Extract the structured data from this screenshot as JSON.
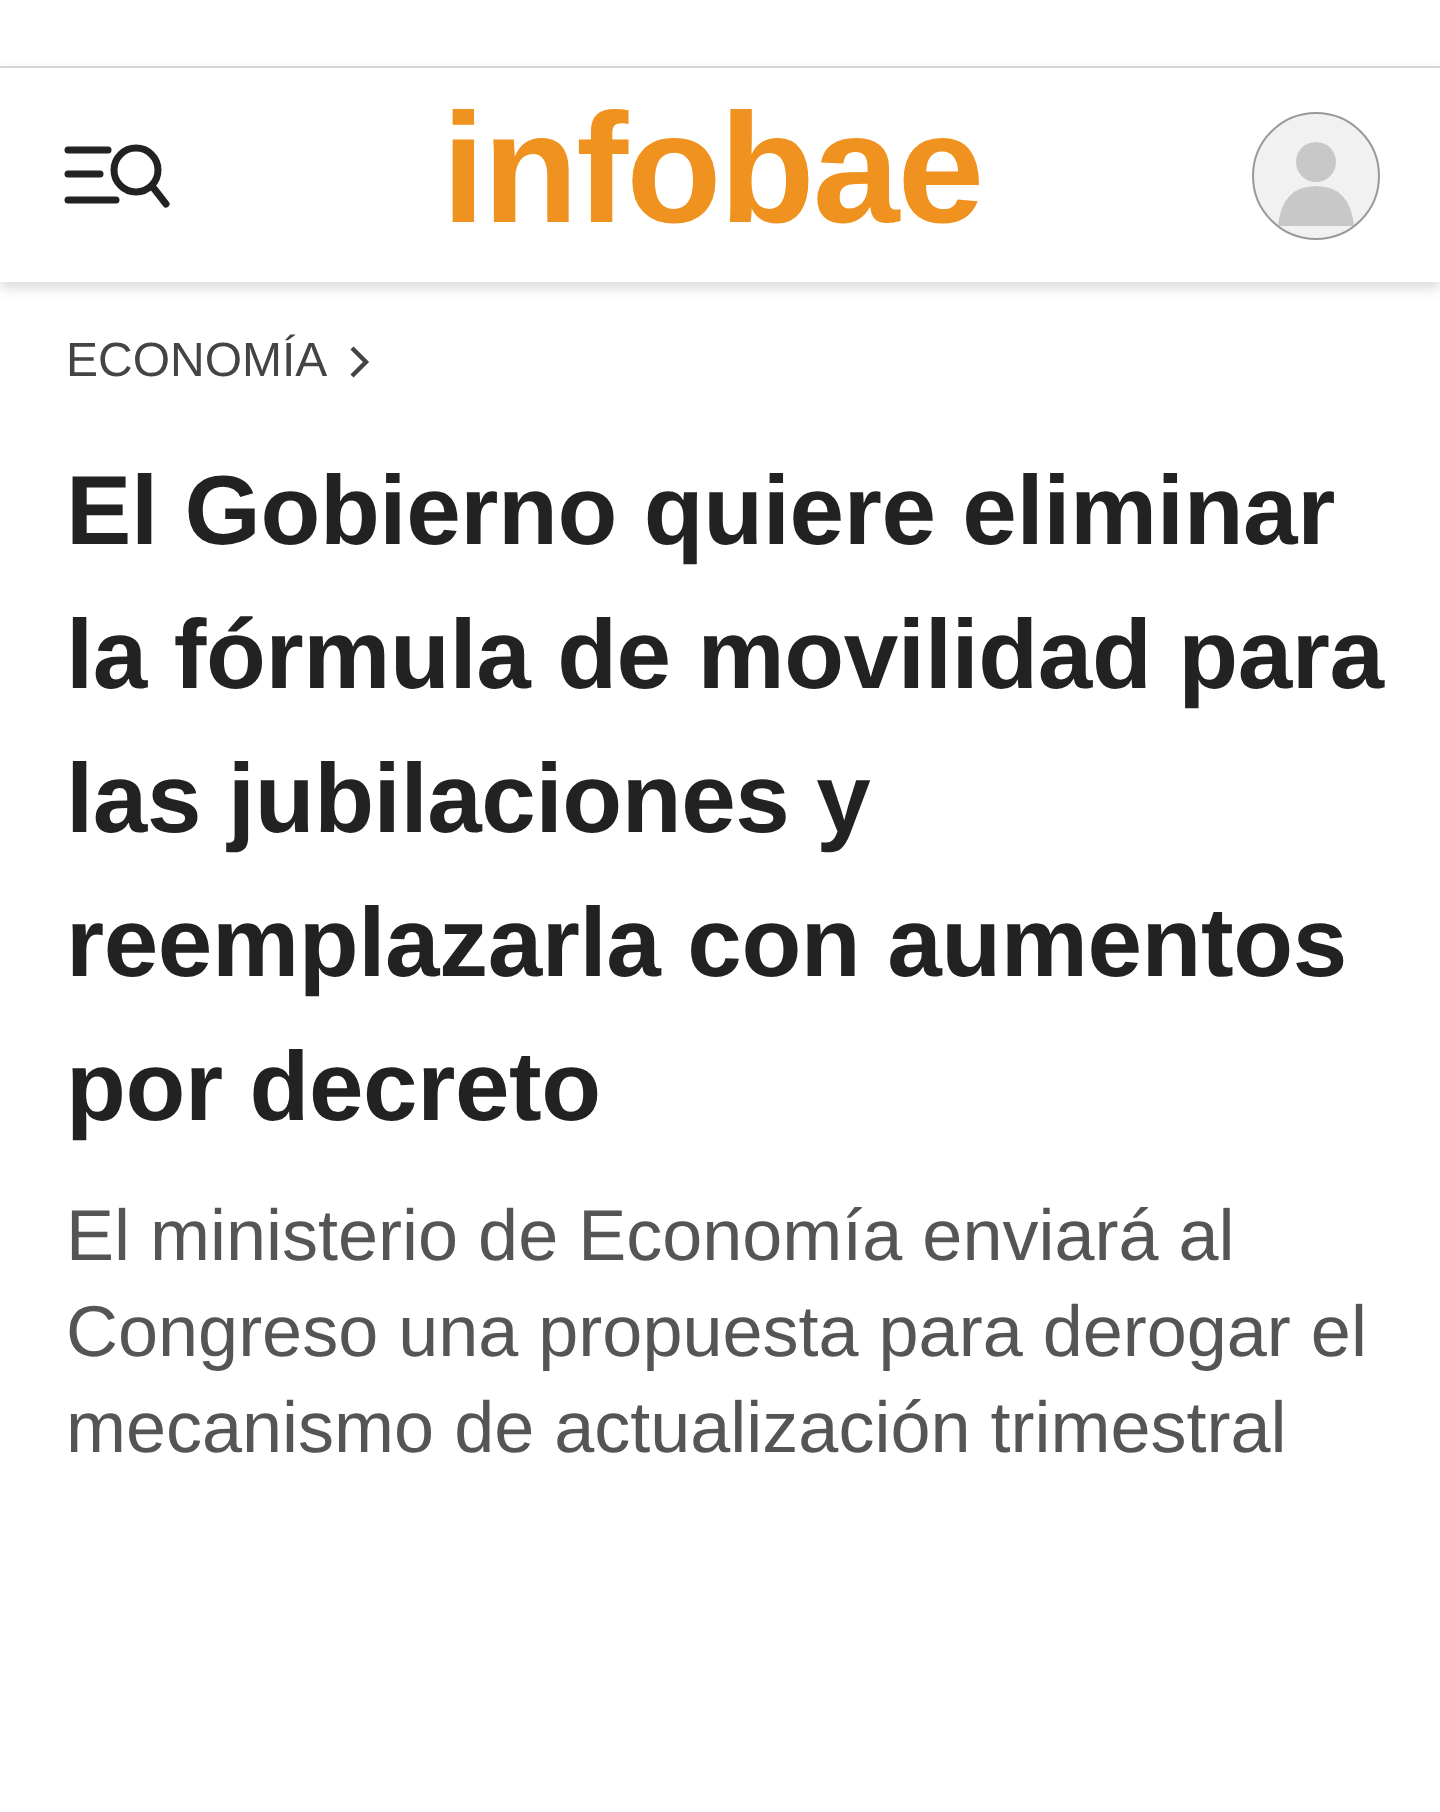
{
  "header": {
    "logo": "infobae"
  },
  "article": {
    "section": "ECONOMÍA",
    "headline": "El Gobierno quiere eliminar la fórmula de movilidad para las jubilaciones y reemplazarla con aumentos por decreto",
    "summary": "El ministerio de Economía enviará al Congreso una propuesta para derogar el mecanismo de actualización trimestral"
  }
}
